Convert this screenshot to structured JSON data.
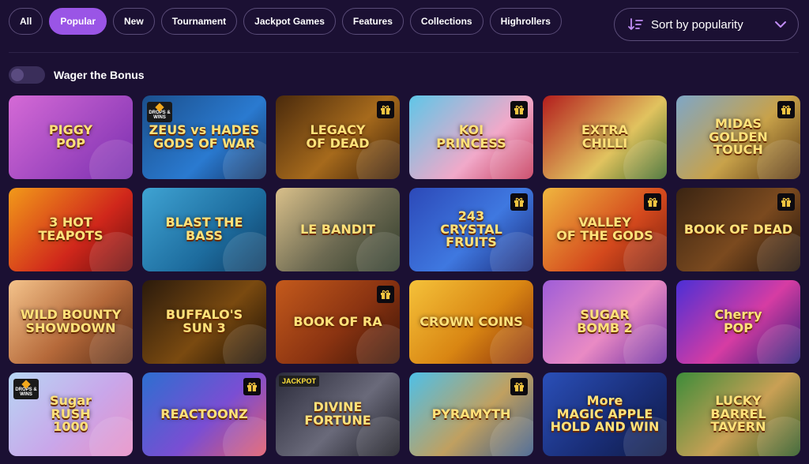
{
  "tabs": [
    {
      "label": "All",
      "active": false
    },
    {
      "label": "Popular",
      "active": true
    },
    {
      "label": "New",
      "active": false
    },
    {
      "label": "Tournament",
      "active": false
    },
    {
      "label": "Jackpot Games",
      "active": false
    },
    {
      "label": "Features",
      "active": false
    },
    {
      "label": "Collections",
      "active": false
    },
    {
      "label": "Highrollers",
      "active": false
    }
  ],
  "sort": {
    "label": "Sort by popularity",
    "icon": "sort-descending-icon"
  },
  "wager": {
    "label": "Wager the Bonus",
    "enabled": false
  },
  "colors": {
    "background": "#1b1033",
    "accent": "#9a55e6",
    "border": "#5a4c78"
  },
  "games": [
    {
      "title": "PIGGY\nPOP",
      "bg": "linear-gradient(135deg,#d56ad6,#7a2fb0)",
      "gift": false,
      "badge": ""
    },
    {
      "title": "ZEUS vs HADES\nGODS OF WAR",
      "bg": "linear-gradient(135deg,#1b4f8c,#2a7ad0 60%,#143463)",
      "gift": false,
      "badge": "drops"
    },
    {
      "title": "LEGACY\nOF DEAD",
      "bg": "linear-gradient(135deg,#4a2a0c,#a66a1c 55%,#3a1e08)",
      "gift": true,
      "badge": ""
    },
    {
      "title": "KOI\nPRINCESS",
      "bg": "linear-gradient(135deg,#5ec6e8,#f1a9c9 60%,#c63b5c)",
      "gift": true,
      "badge": ""
    },
    {
      "title": "EXTRA\nCHILLI",
      "bg": "linear-gradient(135deg,#b31d1d,#e1c35f 60%,#3f6b2a)",
      "gift": false,
      "badge": ""
    },
    {
      "title": "MIDAS\nGOLDEN TOUCH",
      "bg": "linear-gradient(135deg,#7ea6c7,#c8a24a 55%,#5a3813)",
      "gift": true,
      "badge": ""
    },
    {
      "title": "3 HOT\nTEAPOTS",
      "bg": "linear-gradient(135deg,#f29a1a,#d0271b 60%,#6b0f0f)",
      "gift": false,
      "badge": ""
    },
    {
      "title": "BLAST THE\nBASS",
      "bg": "linear-gradient(135deg,#3fa3d3,#1d6c9e 60%,#0f3c63)",
      "gift": false,
      "badge": ""
    },
    {
      "title": "LE BANDIT",
      "bg": "linear-gradient(135deg,#d9c08a,#6d6a52 55%,#2f3b2a)",
      "gift": false,
      "badge": ""
    },
    {
      "title": "243\nCRYSTAL\nFRUITS",
      "bg": "linear-gradient(135deg,#2c49b8,#3f78e0 55%,#1b2a78)",
      "gift": true,
      "badge": ""
    },
    {
      "title": "VALLEY\nOF THE GODS",
      "bg": "linear-gradient(135deg,#f0b63f,#d4491d 60%,#7a1f0f)",
      "gift": true,
      "badge": ""
    },
    {
      "title": "BOOK OF DEAD",
      "bg": "linear-gradient(135deg,#3a2412,#7b4a1f 55%,#1f120a)",
      "gift": true,
      "badge": ""
    },
    {
      "title": "WILD BOUNTY\nSHOWDOWN",
      "bg": "linear-gradient(135deg,#f4c38b,#b5693a 55%,#5a2e17)",
      "gift": false,
      "badge": ""
    },
    {
      "title": "BUFFALO'S\nSUN 3",
      "bg": "linear-gradient(135deg,#2a1a0c,#7a4a10 55%,#1a0f05)",
      "gift": false,
      "badge": ""
    },
    {
      "title": "BOOK OF RA",
      "bg": "linear-gradient(135deg,#c45a1c,#8a3311 55%,#3b1507)",
      "gift": true,
      "badge": ""
    },
    {
      "title": "CROWN COINS",
      "bg": "linear-gradient(135deg,#f5c23a,#d98613 55%,#8a2f0b)",
      "gift": false,
      "badge": ""
    },
    {
      "title": "SUGAR\nBOMB 2",
      "bg": "linear-gradient(135deg,#9f5dd8,#e98ac4 55%,#6d2ea3)",
      "gift": false,
      "badge": ""
    },
    {
      "title": "Cherry\nPOP",
      "bg": "linear-gradient(135deg,#4b2fd6,#d63ca3 55%,#2a1f7a)",
      "gift": false,
      "badge": ""
    },
    {
      "title": "Sugar\nRUSH\n1000",
      "bg": "linear-gradient(135deg,#b7d6f4,#c9a7ea 55%,#e88fc6)",
      "gift": false,
      "badge": "drops"
    },
    {
      "title": "REACTOONZ",
      "bg": "linear-gradient(135deg,#2d6fd0,#7a4ed3 55%,#e25b6b)",
      "gift": true,
      "badge": ""
    },
    {
      "title": "DIVINE FORTUNE",
      "bg": "linear-gradient(135deg,#2a2a3a,#6a6a7a 55%,#1a1a22)",
      "gift": false,
      "badge": "jackpot"
    },
    {
      "title": "PYRAMYTH",
      "bg": "linear-gradient(135deg,#4ec0e8,#c0a060 55%,#3d5c8a)",
      "gift": true,
      "badge": ""
    },
    {
      "title": "More\nMAGIC APPLE\nHOLD AND WIN",
      "bg": "linear-gradient(135deg,#2a4fb8,#1a2f7a 55%,#0f1a45)",
      "gift": false,
      "badge": ""
    },
    {
      "title": "LUCKY\nBARREL\nTAVERN",
      "bg": "linear-gradient(135deg,#3d8c3a,#c9a055 55%,#2e5a24)",
      "gift": false,
      "badge": ""
    }
  ],
  "badges": {
    "drops": "DROPS & WINS",
    "jackpot": "JACKPOT"
  }
}
